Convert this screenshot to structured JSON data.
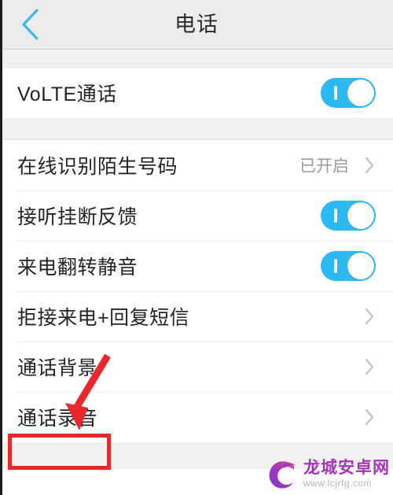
{
  "header": {
    "title": "电话",
    "back_icon": "chevron-left-icon",
    "accent_color": "#3cb4f0"
  },
  "groups": [
    {
      "rows": [
        {
          "label": "VoLTE通话",
          "control": "toggle",
          "toggle_on": true
        }
      ]
    },
    {
      "rows": [
        {
          "label": "在线识别陌生号码",
          "control": "value-chevron",
          "value": "已开启"
        },
        {
          "label": "接听挂断反馈",
          "control": "toggle",
          "toggle_on": true
        },
        {
          "label": "来电翻转静音",
          "control": "toggle",
          "toggle_on": true
        },
        {
          "label": "拒接来电+回复短信",
          "control": "chevron"
        },
        {
          "label": "通话背景",
          "control": "chevron"
        },
        {
          "label": "通话录音",
          "control": "chevron",
          "highlighted": true
        }
      ]
    }
  ],
  "annotations": {
    "arrow_color": "#e8282d",
    "box_color": "#e8282d"
  },
  "watermark": {
    "name": "龙城安卓网",
    "url": "www.lcjrfg.com",
    "logo_icon": "dragon-c-logo-icon",
    "color": "#a32ab5"
  },
  "colors": {
    "toggle_on": "#2cb8f0",
    "header_bg": "#ececec",
    "group_gap": "#f1f1f1",
    "label": "#242424",
    "value": "#9b9b9b"
  }
}
